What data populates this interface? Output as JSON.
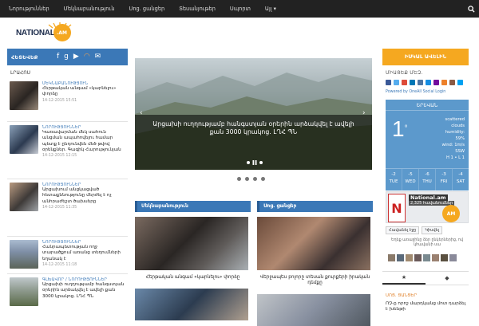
{
  "topnav": {
    "items": [
      "Նորություններ",
      "Մեկնաբանություն",
      "Սոց. ցանցեր",
      "Տեսանյութեր",
      "Սպորտ",
      "Այլ ▾"
    ]
  },
  "logo": {
    "text": "NATIONAL",
    "badge": ".AM"
  },
  "left": {
    "header": "ՀԵՏԵՎԵՔ",
    "live_label": "ԼՐԱՀՈՍ",
    "news": [
      {
        "cat": "ՄԵԿՆԱԲԱՆՈՒԹՅՈՒՆ",
        "title": "Հերթական անգամ «կարնելու» փորձը",
        "time": "14-12-2015 15:51"
      },
      {
        "cat": "ՆՈՐՈՒԹՅՈՒՆՆԵՐ",
        "title": "Կառավարման մեկ սահուն անցման ապահովելու համար պետք է ընդունվեն մեծ թվով օրենքներ. Գագիկ Հարությունյան",
        "time": "14-12-2015 12:15"
      },
      {
        "cat": "ՆՈՐՈՒԹՅՈՒՆՆԵՐ",
        "title": "Արցախում անցկացված հետաքննությունը մերժել է ոչ անհրաժեշտ ծախսերը",
        "time": "14-12-2015 11:35"
      },
      {
        "cat": "ՆՈՐՈՒԹՅՈՒՆՆԵՐ",
        "title": "Հանրապետության ողջ տարածքում առանց տեղումների եղանակ է",
        "time": "14-12-2015 11:18"
      },
      {
        "cat": "ԳԼԽԱՎՈՐ / ՆՈՐՈՒԹՅՈՒՆՆԵՐ",
        "title": "Արցախի ուղղությամբ հանգստյան օրերին արձակվել է ավելի քան 3000 կրակոց. ԼՂՀ ՊՆ",
        "time": ""
      }
    ]
  },
  "slider": {
    "caption": "Արցախի ուղղությամբ հանգստյան օրերին արձակվել է ավելի քան 3000 կրակոց. ԼՂՀ ՊՆ"
  },
  "boxes": [
    {
      "header": "Մեկնաբանություն",
      "title": "Հերթական անգամ «կարնելու» փորձը"
    },
    {
      "header": "Սոց. ցանցեր",
      "title": "Վերջապես բոլորը տեսան քուրքերի իրական դեմքը"
    }
  ],
  "right": {
    "header": "ԻՍԿԱԼ ԱՎԵԼԻՆ",
    "share_label": "ՄԻԱՑԵՔ ՄԵԶ.",
    "powered": "Powered by OneAll Social Login",
    "weather": {
      "city": "ԵՐԵՎԱՆ",
      "temp": "1",
      "deg": "°",
      "desc": [
        "scattered",
        "clouds",
        "humidity:",
        "59%",
        "wind: 1m/s",
        "SSW",
        "H 1 • L 1"
      ],
      "forecast": [
        {
          "t": "-2",
          "d": "TUE"
        },
        {
          "t": "-5",
          "d": "WED"
        },
        {
          "t": "-6",
          "d": "THU"
        },
        {
          "t": "-3",
          "d": "FRI"
        },
        {
          "t": "-4",
          "d": "SAT"
        }
      ]
    },
    "fb": {
      "title": "National.am",
      "sub": "2,325 հավանումներ",
      "badge": "AM",
      "like": "Հավանել էջը",
      "share": "Կիսվել",
      "friends": "Եղեք առաջինը ձեր ընկերներից, ով կհավանի սա"
    },
    "tag_label": "ՍՈՑ. ՑԱՆՑԵՐ",
    "tag_text": "ՈՉ-ը որոշ մարդկանց մոտ դարձել է խենթի"
  }
}
